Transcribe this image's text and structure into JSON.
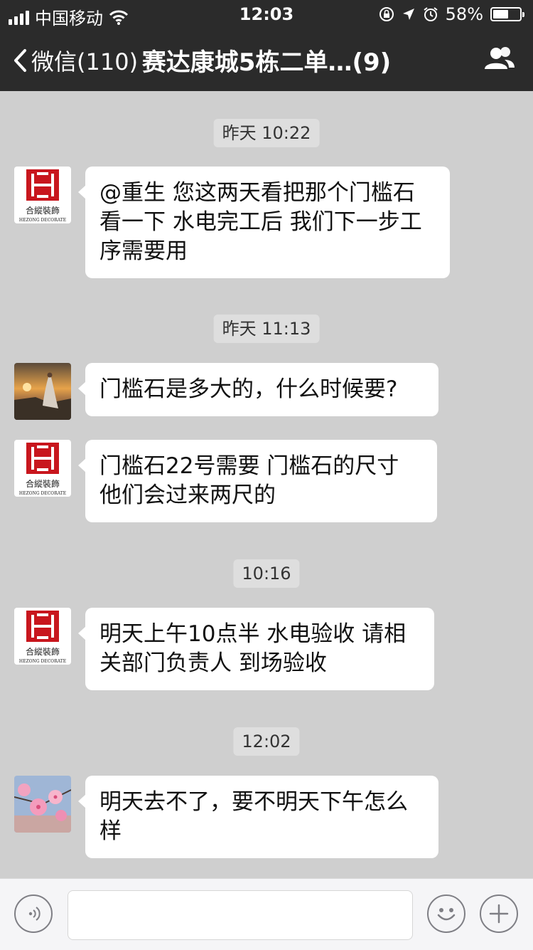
{
  "status": {
    "carrier": "中国移动",
    "time": "12:03",
    "battery": "58%",
    "battery_level": 0.58
  },
  "nav": {
    "back_label": "微信(110)",
    "title": "赛达康城5栋二单…(9)"
  },
  "messages": [
    {
      "type": "time",
      "text": "昨天 10:22"
    },
    {
      "type": "msg",
      "avatar": "hezong-logo",
      "text": "@重生  您这两天看把那个门槛石看一下 水电完工后 我们下一步工序需要用"
    },
    {
      "type": "time",
      "text": "昨天 11:13"
    },
    {
      "type": "msg",
      "avatar": "sunset-photo",
      "text": "门槛石是多大的，什么时候要?"
    },
    {
      "type": "msg",
      "avatar": "hezong-logo",
      "text": " 门槛石22号需要 门槛石的尺寸 他们会过来两尺的"
    },
    {
      "type": "time",
      "text": "10:16"
    },
    {
      "type": "msg",
      "avatar": "hezong-logo",
      "text": " 明天上午10点半 水电验收 请相关部门负责人 到场验收"
    },
    {
      "type": "time",
      "text": "12:02"
    },
    {
      "type": "msg",
      "avatar": "blossom-photo",
      "text": "明天去不了，要不明天下午怎么样"
    }
  ],
  "logo": {
    "name": "合縱裝飾",
    "sub": "HEZONG DECORATE",
    "brand_color": "#c8161d"
  },
  "input": {
    "value": ""
  }
}
